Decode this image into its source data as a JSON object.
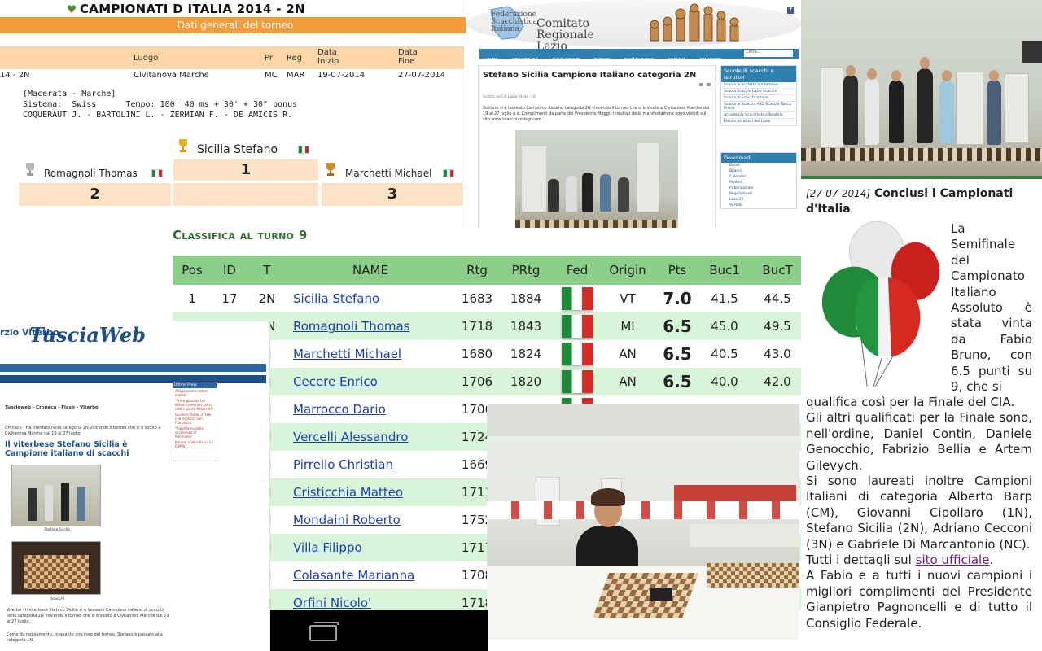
{
  "tournament": {
    "title": "CAMPIONATI D ITALIA 2014 - 2N",
    "subtitle": "Dati generali del torneo",
    "headers": {
      "luogo": "Luogo",
      "pr": "Pr",
      "reg": "Reg",
      "data_inizio": "Data Inizio",
      "data_fine": "Data Fine"
    },
    "row": {
      "code": "14 - 2N",
      "luogo": "Civitanova Marche",
      "pr": "MC",
      "reg": "MAR",
      "inizio": "19-07-2014",
      "fine": "27-07-2014"
    },
    "location_note": "[Macerata - Marche]",
    "system_line": "Sistema:  Swiss      Tempo: 100' 40 ms + 30' + 30\" bonus",
    "arbiters": "COQUERAUT J. - BARTOLINI L. - ZERMIAN F. - DE AMICIS R.",
    "podium": {
      "first_name": "Sicilia Stefano",
      "first_num": "1",
      "second_name": "Romagnoli Thomas",
      "second_num": "2",
      "third_name": "Marchetti Michael",
      "third_num": "3"
    }
  },
  "lazio": {
    "federation": "Federazione Scacchistica Italiana",
    "brand": "Comitato Regionale Lazio",
    "nav": [
      "HOME",
      "STRUTTURA",
      "DOCUMENTI",
      "EVENTI",
      "FORMAZIONE",
      "STAMPA",
      "CONTATTI"
    ],
    "search_placeholder": "Cerca...",
    "article_title": "Stefano Sicilia Campione Italiano categoria 2N",
    "meta": "Scritto da CR Lazio    Visite: 16",
    "body": "Stefano si è laureato Campione Italiano categoria 2N vincendo il torneo che si è svolto a Civitanova Marche dal 19 al 27 luglio u.s. Complimenti da parte del Presidente Maggi. I risultati della manifestazione sono visibili sul sito www.scacchiandagi.com",
    "side1_title": "Scuole di scacchi e Istruttori",
    "side1_items": [
      "Scuola Scacchistica Viterbese",
      "Scuola Scacchi Lazio Scacchi",
      "Scuola di Scacchi Vitinia",
      "Scuola di Scacchi ASD Scacchi Rocca Priora",
      "Accademia Scacchistica Beatina",
      "Elenco Istruttori del Lazio"
    ],
    "side2_title": "Download",
    "side2_items": [
      "Bandi",
      "Bilanci",
      "Calendari",
      "Moduli",
      "Pubblicazioni",
      "Regolamenti",
      "Lazio14",
      "Verbali"
    ]
  },
  "classifica": {
    "title": "Classifica al turno 9",
    "columns": [
      "Pos",
      "ID",
      "T",
      "NAME",
      "Rtg",
      "PRtg",
      "Fed",
      "Origin",
      "Pts",
      "Buc1",
      "BucT"
    ],
    "rows": [
      {
        "pos": "1",
        "id": "17",
        "t": "2N",
        "name": "Sicilia Stefano",
        "rtg": "1683",
        "prtg": "1884",
        "origin": "VT",
        "pts": "7.0",
        "buc1": "41.5",
        "buct": "44.5"
      },
      {
        "pos": "2",
        "id": "7",
        "t": "2N",
        "name": "Romagnoli Thomas",
        "rtg": "1718",
        "prtg": "1843",
        "origin": "MI",
        "pts": "6.5",
        "buc1": "45.0",
        "buct": "49.5"
      },
      {
        "pos": "",
        "id": "",
        "t": "N",
        "name": "Marchetti Michael",
        "rtg": "1680",
        "prtg": "1824",
        "origin": "AN",
        "pts": "6.5",
        "buc1": "40.5",
        "buct": "43.0"
      },
      {
        "pos": "",
        "id": "",
        "t": "N",
        "name": "Cecere Enrico",
        "rtg": "1706",
        "prtg": "1820",
        "origin": "AN",
        "pts": "6.5",
        "buc1": "40.0",
        "buct": "42.0"
      },
      {
        "pos": "",
        "id": "",
        "t": "N",
        "name": "Marrocco Dario",
        "rtg": "1706",
        "prtg": "",
        "origin": "",
        "pts": "",
        "buc1": "",
        "buct": ""
      },
      {
        "pos": "",
        "id": "",
        "t": "N",
        "name": "Vercelli Alessandro",
        "rtg": "1724",
        "prtg": "",
        "origin": "",
        "pts": "",
        "buc1": "",
        "buct": ""
      },
      {
        "pos": "",
        "id": "",
        "t": "N",
        "name": "Pirrello Christian",
        "rtg": "1669",
        "prtg": "",
        "origin": "",
        "pts": "",
        "buc1": "",
        "buct": ""
      },
      {
        "pos": "",
        "id": "",
        "t": "N",
        "name": "Cristicchia Matteo",
        "rtg": "1711",
        "prtg": "",
        "origin": "",
        "pts": "",
        "buc1": "",
        "buct": ""
      },
      {
        "pos": "",
        "id": "",
        "t": "N",
        "name": "Mondaini Roberto",
        "rtg": "1752",
        "prtg": "",
        "origin": "",
        "pts": "",
        "buc1": "",
        "buct": ""
      },
      {
        "pos": "",
        "id": "",
        "t": "N",
        "name": "Villa Filippo",
        "rtg": "1717",
        "prtg": "",
        "origin": "",
        "pts": "",
        "buc1": "",
        "buct": ""
      },
      {
        "pos": "",
        "id": "",
        "t": "N",
        "name": "Colasante Marianna",
        "rtg": "1708",
        "prtg": "",
        "origin": "",
        "pts": "",
        "buc1": "",
        "buct": ""
      },
      {
        "pos": "",
        "id": "",
        "t": "N",
        "name": "Orfini Nicolo'",
        "rtg": "1718",
        "prtg": "",
        "origin": "",
        "pts": "",
        "buc1": "",
        "buct": ""
      }
    ]
  },
  "tuscia": {
    "logo": "TusciaWeb",
    "logo_left": "rzio Viterbo",
    "nav1": [
      "Economia",
      "Agricoltura",
      "Salute",
      "Cultura",
      "Spettacolo",
      "Sport",
      "Flash",
      "Opinione",
      "TusciawebTV",
      "Gallery",
      "Archivio",
      "Chi Siamo"
    ],
    "nav2": [
      "App",
      "Facebook",
      "Tusciaweb-tube",
      "MercatinoWeb",
      "Twitter",
      "SalaStampa",
      "TusciawebOld",
      "S. Rosa"
    ],
    "crumb": "Tusciaweb - Cronaca - Flash - Viterbo",
    "kicker": "Cronaca - Ha trionfato nella categoria 2N vincendo il torneo che si è svolto a Civitanova Marche dal 19 al 27 luglio",
    "headline": "Il viterbese Stefano Sicilia è Campione italiano di scacchi",
    "cap1": "Stefano Sicilia",
    "cap2": "Scacchi",
    "text": "Viterbo - Il viterbese Stefano Sicilia si è laureato Campione italiano di scacchi nella categoria 2N vincendo il torneo che si è svolto a Civitanova Marche dal 19 al 27 luglio.",
    "text2": "Come da regolamento, in quanto vincitore del torneo, Stefano è passato alla categoria 1N.",
    "side_title": "Ultime Press",
    "side_items": [
      "Allagamenti e alberi crollati",
      "\"Prato giardino tra bidoni rovesciati, vetri rotti e giochi fatiscenti\"",
      "Giovanni Auda, il frate che ricostruì San Francesco",
      "\"Ripartiamo dalle eccellenze al femminile\"",
      "Borgne a Vetralla (ora il FIAMS)"
    ]
  },
  "article": {
    "date": "[27-07-2014]",
    "title": "Conclusi i Campionati d'Italia",
    "lead": "La Semifinale del Campionato Italiano Assoluto è stata vinta da Fabio Bruno, con 6.5 punti su 9, che si",
    "p1": "qualifica così per la Finale del CIA.",
    "p2": "Gli altri qualificati per la Finale sono, nell'ordine, Daniel Contin, Daniele Genocchio, Fabrizio Bellia e Artem Gilevych.",
    "p3": "Si sono laureati inoltre Campioni Italiani di categoria Alberto Barp (CM), Giovanni Cipollaro (1N), Stefano Sicilia (2N), Adriano Cecconi (3N) e Gabriele Di Marcantonio (NC).",
    "p4_pre": "Tutti i dettagli sul ",
    "p4_link": "sito ufficiale",
    "p4_post": ".",
    "p5": "A Fabio e a tutti i nuovi campioni i migliori complimenti del Presidente Gianpietro Pagnoncelli e di tutto il Consiglio Federale."
  },
  "colors": {
    "orange": "#f39c3b",
    "green_header": "#8bcf8b",
    "green_alt": "#d9f5d9",
    "link_blue": "#1b3fb5",
    "lazio_blue": "#2f7fb0"
  }
}
